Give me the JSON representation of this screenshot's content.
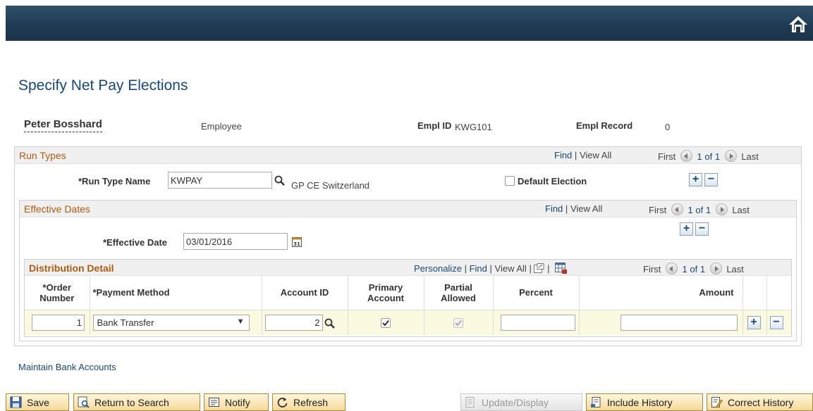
{
  "page": {
    "title": "Specify Net Pay Elections"
  },
  "employee": {
    "name": "Peter Bosshard",
    "type": "Employee",
    "emplid_label": "Empl ID",
    "emplid": "KWG101",
    "emplrec_label": "Empl Record",
    "emplrec": "0"
  },
  "run_types": {
    "title": "Run Types",
    "find": "Find",
    "sep": "|",
    "view_all": "View All",
    "first": "First",
    "page": "1 of 1",
    "last": "Last",
    "run_type_label": "*Run Type Name",
    "run_type_value": "KWPAY",
    "run_type_desc": "GP CE Switzerland",
    "default_election_label": "Default Election",
    "default_election_checked": false
  },
  "effective_dates": {
    "title": "Effective Dates",
    "find": "Find",
    "sep": "|",
    "view_all": "View All",
    "first": "First",
    "page": "1 of 1",
    "last": "Last",
    "date_label": "*Effective Date",
    "date_value": "03/01/2016"
  },
  "distribution": {
    "title": "Distribution Detail",
    "personalize": "Personalize",
    "find": "Find",
    "view_all": "View All",
    "sep": "|",
    "first": "First",
    "page": "1 of 1",
    "last": "Last",
    "columns": {
      "order_1": "*Order",
      "order_2": "Number",
      "payment": "*Payment Method",
      "account": "Account ID",
      "primary_1": "Primary",
      "primary_2": "Account",
      "partial_1": "Partial",
      "partial_2": "Allowed",
      "percent": "Percent",
      "amount": "Amount"
    },
    "row": {
      "order": "1",
      "payment": "Bank Transfer",
      "account": "2",
      "primary": true,
      "partial": true,
      "percent": "",
      "amount": ""
    }
  },
  "links": {
    "maintain_bank": "Maintain Bank Accounts"
  },
  "toolbar": {
    "save": "Save",
    "return": "Return to Search",
    "notify": "Notify",
    "refresh": "Refresh",
    "update": "Update/Display",
    "include_history": "Include History",
    "correct_history": "Correct History"
  },
  "colors": {
    "header": "#1e3a52",
    "link": "#18477a",
    "section_title": "#b15b11",
    "row_bg": "#fafae0"
  }
}
